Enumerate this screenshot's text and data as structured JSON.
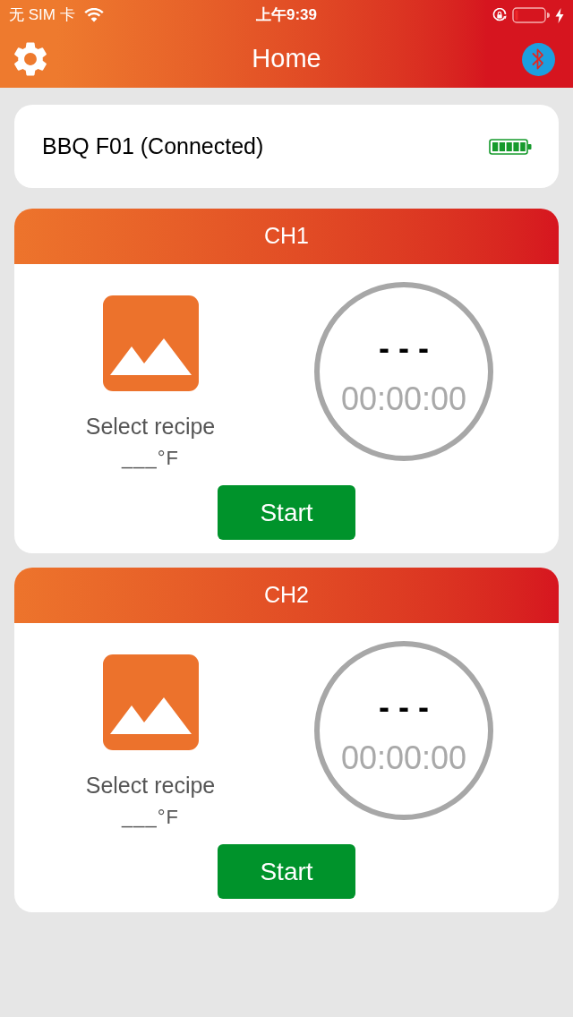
{
  "status_bar": {
    "carrier": "无 SIM 卡",
    "time": "上午9:39"
  },
  "nav_bar": {
    "title": "Home"
  },
  "device": {
    "name": "BBQ F01 (Connected)"
  },
  "channels": [
    {
      "title": "CH1",
      "recipe": "Select recipe",
      "target_temp": "___°F",
      "temperature": "- - -",
      "timer": "00:00:00",
      "button": "Start"
    },
    {
      "title": "CH2",
      "recipe": "Select recipe",
      "target_temp": "___°F",
      "temperature": "- - -",
      "timer": "00:00:00",
      "button": "Start"
    }
  ]
}
